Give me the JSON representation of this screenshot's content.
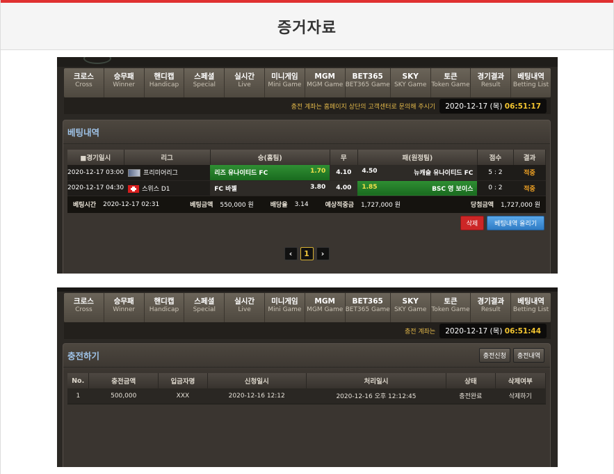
{
  "page": {
    "title": "증거자료"
  },
  "nav": [
    {
      "ko": "크로스",
      "en": "Cross"
    },
    {
      "ko": "승무패",
      "en": "Winner"
    },
    {
      "ko": "핸디캡",
      "en": "Handicap"
    },
    {
      "ko": "스페셜",
      "en": "Special"
    },
    {
      "ko": "실시간",
      "en": "Live"
    },
    {
      "ko": "미니게임",
      "en": "Mini Game"
    },
    {
      "ko": "MGM",
      "en": "MGM Game"
    },
    {
      "ko": "BET365",
      "en": "BET365 Game"
    },
    {
      "ko": "SKY",
      "en": "SKY Game"
    },
    {
      "ko": "토큰",
      "en": "Token Game"
    },
    {
      "ko": "경기결과",
      "en": "Result"
    },
    {
      "ko": "베팅내역",
      "en": "Betting List"
    }
  ],
  "shot1": {
    "notice": "충전 계좌는 홈페이지 상단의 고객센터로 문의해 주시기",
    "clock_date": "2020-12-17 (목)",
    "clock_time": "06:51:17",
    "panel_title": "베팅내역",
    "headers": [
      "■경기일시",
      "리그",
      "승(홈팀)",
      "무",
      "패(원정팀)",
      "점수",
      "결과"
    ],
    "rows": [
      {
        "date": "2020-12-17 03:00",
        "league": "프리미어리그",
        "home": "리즈 유나이티드 FC",
        "home_odd": "1.70",
        "draw": "4.10",
        "away_odd": "4.50",
        "away": "뉴캐슬 유나이티드 FC",
        "score": "5 : 2",
        "result": "적중"
      },
      {
        "date": "2020-12-17 04:30",
        "league": "스위스 D1",
        "home": "FC 바젤",
        "home_odd": "3.80",
        "draw": "4.00",
        "away_odd": "1.85",
        "away": "BSC 영 보이스",
        "score": "0 : 2",
        "result": "적중"
      }
    ],
    "summary": {
      "bet_time_label": "베팅시간",
      "bet_time": "2020-12-17 02:31",
      "amount_label": "베팅금액",
      "amount": "550,000 원",
      "odds_label": "배당율",
      "odds": "3.14",
      "expected_label": "예상적중금",
      "expected": "1,727,000 원",
      "win_label": "당첨금액",
      "win": "1,727,000 원"
    },
    "delete_label": "삭제",
    "upload_label": "베팅내역 올리기",
    "page_number": "1",
    "prev_icon": "‹",
    "next_icon": "›"
  },
  "shot2": {
    "notice": "충전 계좌는",
    "clock_date": "2020-12-17 (목)",
    "clock_time": "06:51:44",
    "panel_title": "충전하기",
    "btn_request": "충전신청",
    "btn_history": "충전내역",
    "headers": [
      "No.",
      "충전금액",
      "입금자명",
      "신청일시",
      "처리일시",
      "상태",
      "삭제여부"
    ],
    "rows": [
      {
        "no": "1",
        "amount": "500,000",
        "name": "XXX",
        "requested": "2020-12-16 12:12",
        "processed": "2020-12-16 오후 12:12:45",
        "status": "충전완료",
        "delete": "삭제하기"
      }
    ]
  }
}
